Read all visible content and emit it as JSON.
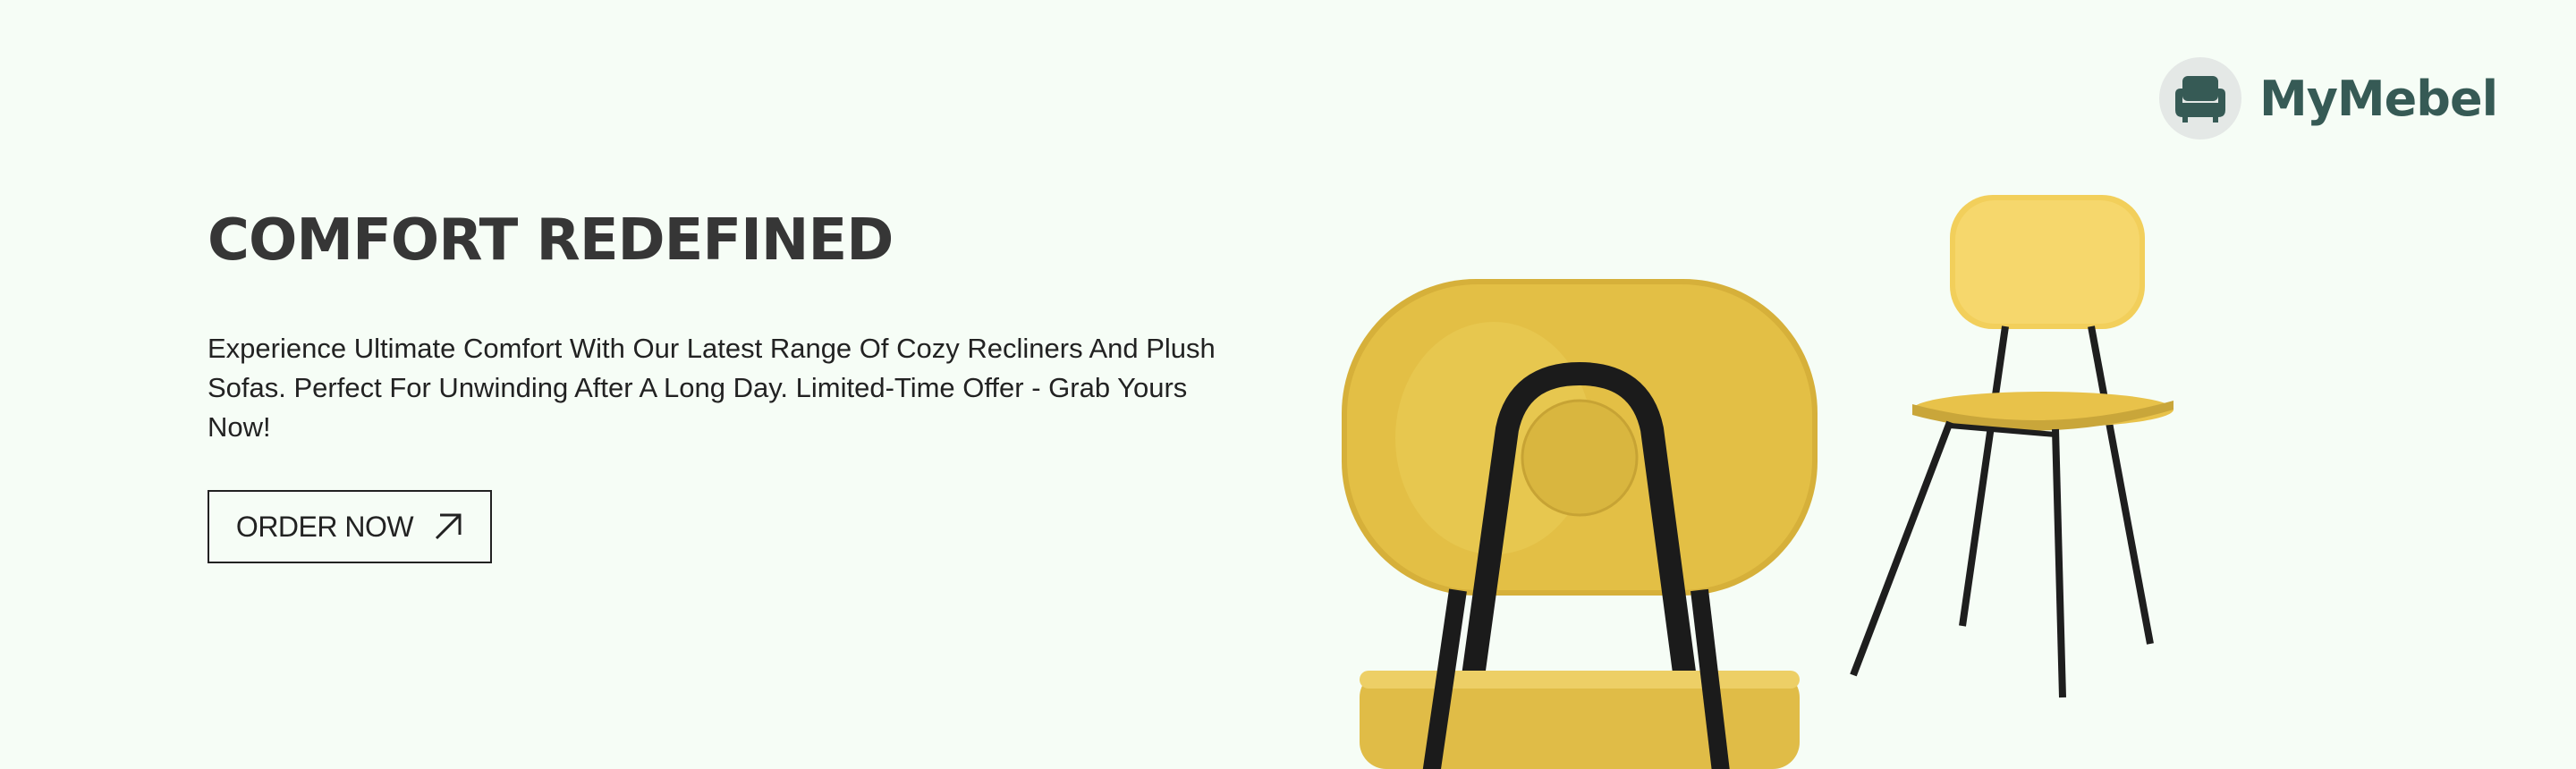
{
  "brand": {
    "name": "MyMebel",
    "icon": "armchair-icon",
    "color": "#365a55"
  },
  "hero": {
    "title": "COMFORT REDEFINED",
    "description": "Experience Ultimate Comfort With Our Latest Range Of Cozy Recliners And Plush Sofas. Perfect For Unwinding After A Long Day. Limited-Time Offer - Grab Yours Now!",
    "cta_label": "ORDER NOW",
    "cta_icon": "arrow-up-right-icon"
  },
  "colors": {
    "background": "#f6fdf6",
    "chair": "#ecc94b",
    "text": "#363636"
  }
}
